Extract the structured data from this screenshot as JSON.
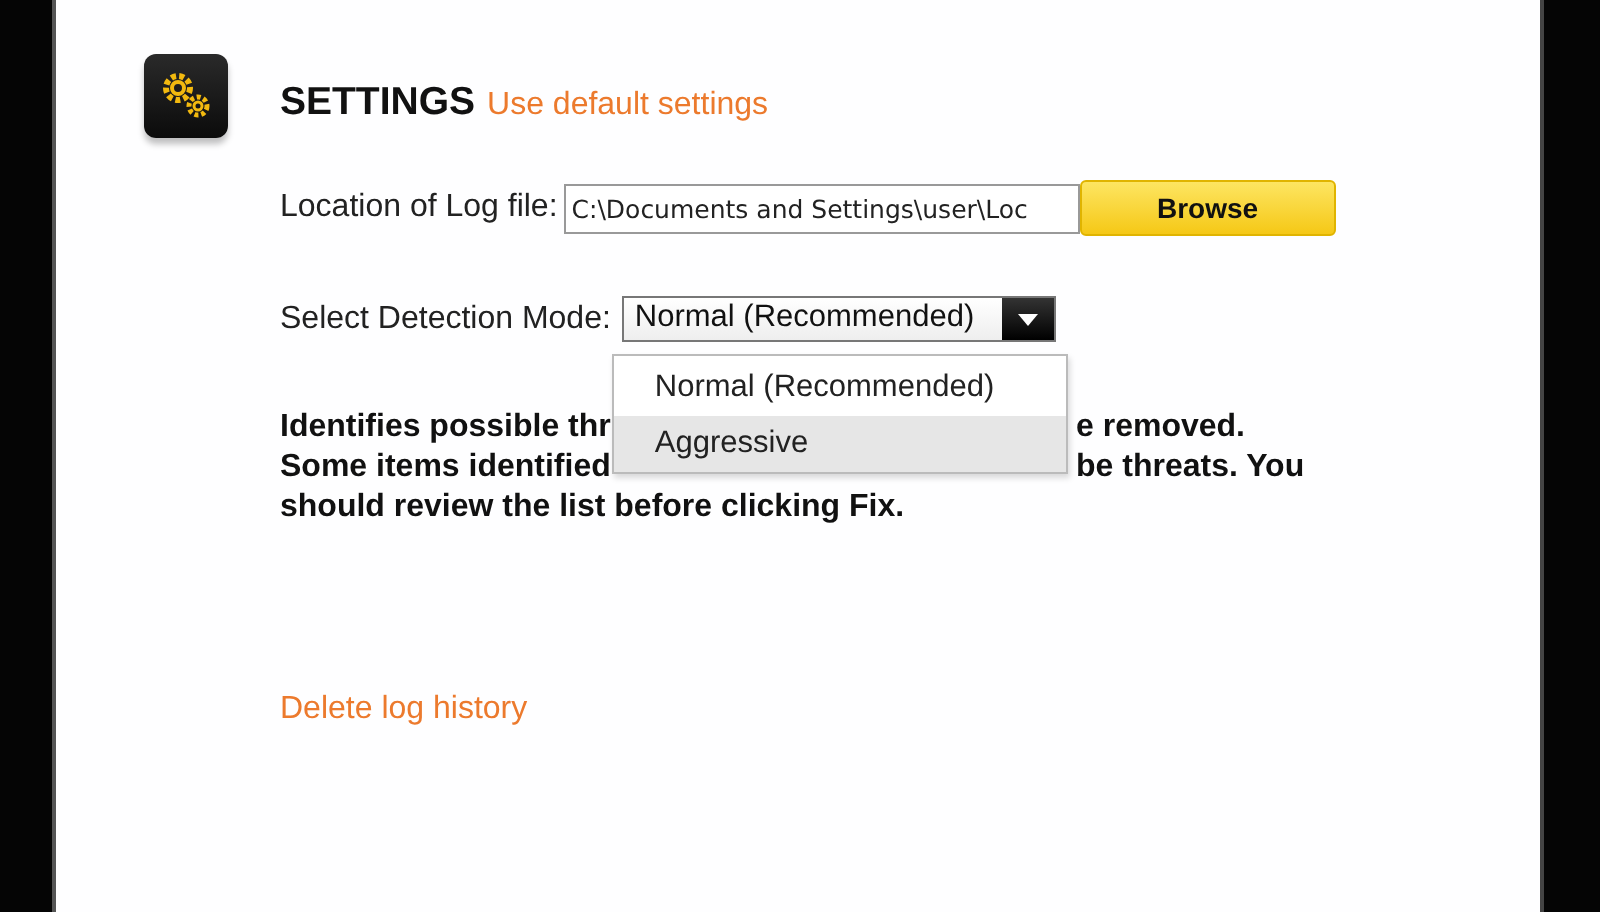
{
  "header": {
    "title": "SETTINGS",
    "link": "Use default settings"
  },
  "log_file": {
    "label": "Location of Log file:",
    "value": "C:\\Documents and Settings\\user\\Loc",
    "button": "Browse"
  },
  "detection": {
    "label": "Select Detection Mode:",
    "value": "Normal (Recommended)",
    "expanded": true,
    "options": [
      {
        "label": "Normal (Recommended)",
        "highlighted": false
      },
      {
        "label": "Aggressive",
        "highlighted": true
      }
    ]
  },
  "description_lines": [
    {
      "left": "Identifies possible thr",
      "right": "e removed."
    },
    {
      "left": "Some items identified",
      "right": "be threats. You"
    },
    {
      "left": "should review the list before clicking Fix."
    }
  ],
  "footer_link": "Delete log history"
}
